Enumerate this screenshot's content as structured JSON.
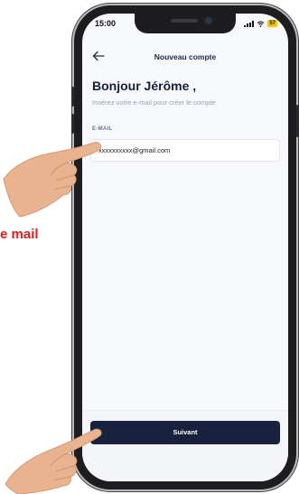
{
  "status_bar": {
    "time": "15:00",
    "battery": "57"
  },
  "nav": {
    "title": "Nouveau compte"
  },
  "greeting": "Bonjour Jérôme ,",
  "subtitle": "Insérez votre e-mail pour créer le compte",
  "email": {
    "label": "E-MAIL",
    "value": "xxxxxxxxxx@gmail.com"
  },
  "footer": {
    "next_label": "Suivant"
  },
  "annotation": {
    "label": "e mail",
    "color": "#e41d1d"
  },
  "colors": {
    "primary": "#18213d",
    "background": "#f7f8fc"
  },
  "icons": [
    "back-arrow-icon",
    "signal-icon",
    "wifi-icon",
    "battery-icon",
    "pointing-hand-icon"
  ]
}
